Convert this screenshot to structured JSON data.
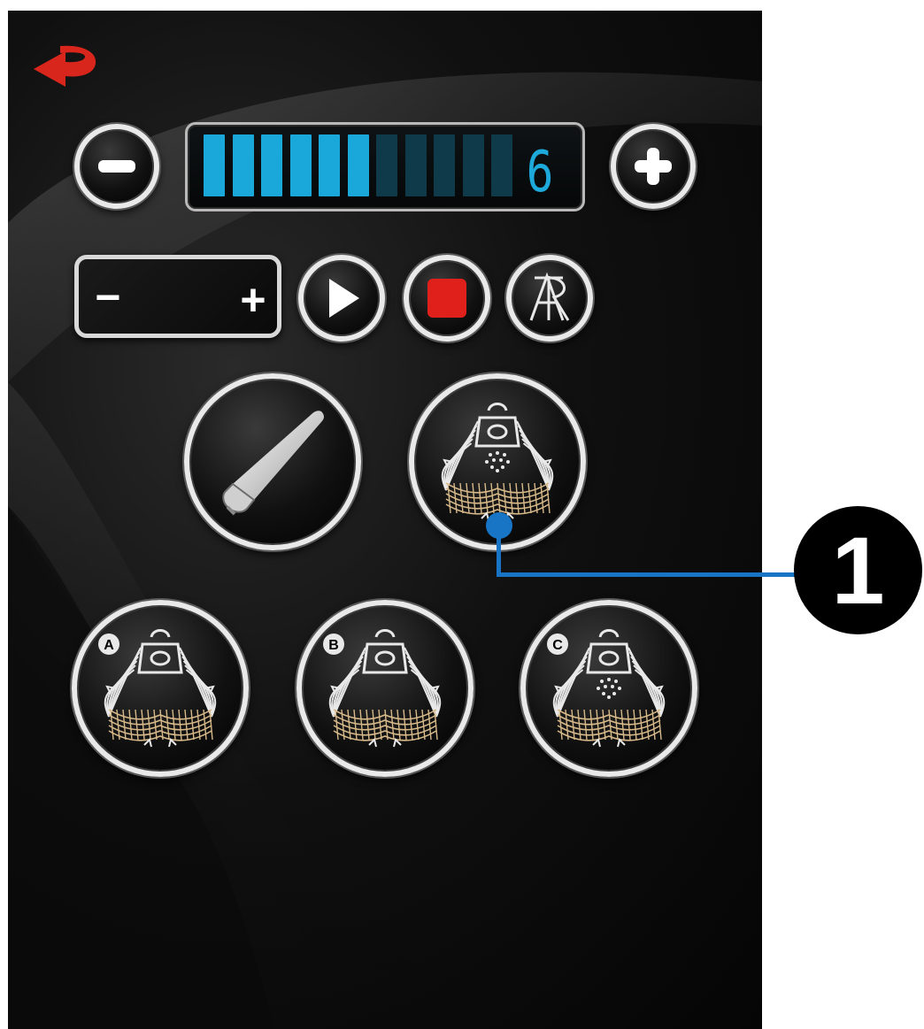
{
  "panel": {
    "back_icon": "back-arrow-icon",
    "intensity": {
      "level": 6,
      "level_text": "6",
      "max_level": 12,
      "active_color": "#1aa8da",
      "inactive_color": "#0e3a4a",
      "decrease_icon": "minus-circle-icon",
      "increase_icon": "plus-circle-icon"
    },
    "time_control": {
      "minus_label": "−",
      "plus_label": "+"
    },
    "playback": {
      "play_icon": "play-icon",
      "stop_icon": "stop-icon",
      "stop_color": "#e0201b",
      "logo_icon": "ar-logo-icon"
    },
    "modes": [
      {
        "icon": "handpiece-icon"
      },
      {
        "icon": "lift-mesh-icon"
      },
      {
        "icon": "lift-mesh-icon",
        "badge": "A"
      },
      {
        "icon": "lift-mesh-icon",
        "badge": "B"
      },
      {
        "icon": "lift-mesh-icon",
        "badge": "C"
      }
    ]
  },
  "callout": {
    "number": "1",
    "color": "#1874c4"
  }
}
